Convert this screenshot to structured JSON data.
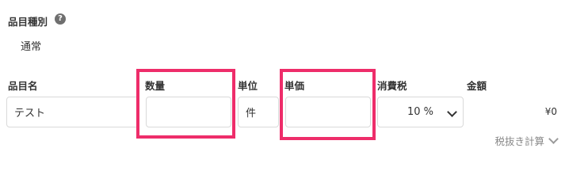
{
  "item_type": {
    "label": "品目種別",
    "help_icon": "question-circle-icon",
    "value": "通常"
  },
  "columns": {
    "item_name": "品目名",
    "quantity": "数量",
    "unit": "単位",
    "unit_price": "単価",
    "tax": "消費税",
    "amount": "金額"
  },
  "row": {
    "item_name": "テスト",
    "quantity": "",
    "unit": "件",
    "unit_price": "",
    "tax_rate": "10 %",
    "amount": "¥0"
  },
  "tax_excluded_toggle": "税抜き計算",
  "colors": {
    "highlight": "#ee2d6a",
    "text": "#333333",
    "muted": "#888888",
    "border": "#d9d9d9"
  }
}
